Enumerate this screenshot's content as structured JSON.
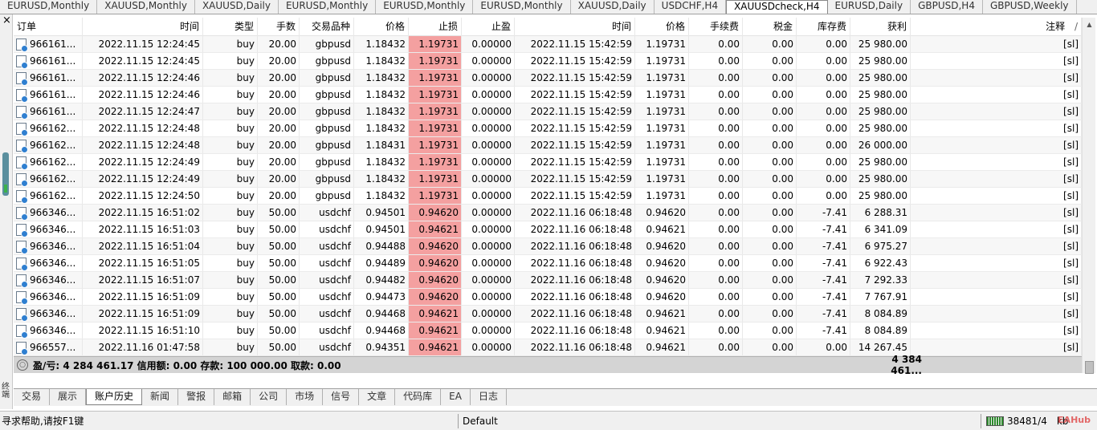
{
  "chart_tabs": [
    {
      "label": "EURUSD,Monthly"
    },
    {
      "label": "XAUUSD,Monthly"
    },
    {
      "label": "XAUUSD,Daily"
    },
    {
      "label": "EURUSD,Monthly"
    },
    {
      "label": "EURUSD,Monthly"
    },
    {
      "label": "EURUSD,Monthly"
    },
    {
      "label": "XAUUSD,Daily"
    },
    {
      "label": "USDCHF,H4"
    },
    {
      "label": "XAUUSDcheck,H4"
    },
    {
      "label": "EURUSD,Daily"
    },
    {
      "label": "GBPUSD,H4"
    },
    {
      "label": "GBPUSD,Weekly"
    }
  ],
  "active_chart_tab": "XAUUSDcheck,H4",
  "close_glyph": "×",
  "strip_label": "终端",
  "columns": {
    "order": "订单",
    "open_time": "时间",
    "type": "类型",
    "lots": "手数",
    "symbol": "交易品种",
    "open_price": "价格",
    "sl": "止损",
    "tp": "止盈",
    "close_time": "时间",
    "close_price": "价格",
    "commission": "手续费",
    "tax": "税金",
    "swap": "库存费",
    "profit": "获利",
    "comment": "注释"
  },
  "sort_glyph": "/",
  "rows": [
    {
      "order": "966161...",
      "open_time": "2022.11.15 12:24:45",
      "type": "buy",
      "lots": "20.00",
      "symbol": "gbpusd",
      "open_price": "1.18432",
      "sl": "1.19731",
      "tp": "0.00000",
      "close_time": "2022.11.15 15:42:59",
      "close_price": "1.19731",
      "commission": "0.00",
      "tax": "0.00",
      "swap": "0.00",
      "profit": "25 980.00",
      "comment": "[sl]"
    },
    {
      "order": "966161...",
      "open_time": "2022.11.15 12:24:45",
      "type": "buy",
      "lots": "20.00",
      "symbol": "gbpusd",
      "open_price": "1.18432",
      "sl": "1.19731",
      "tp": "0.00000",
      "close_time": "2022.11.15 15:42:59",
      "close_price": "1.19731",
      "commission": "0.00",
      "tax": "0.00",
      "swap": "0.00",
      "profit": "25 980.00",
      "comment": "[sl]"
    },
    {
      "order": "966161...",
      "open_time": "2022.11.15 12:24:46",
      "type": "buy",
      "lots": "20.00",
      "symbol": "gbpusd",
      "open_price": "1.18432",
      "sl": "1.19731",
      "tp": "0.00000",
      "close_time": "2022.11.15 15:42:59",
      "close_price": "1.19731",
      "commission": "0.00",
      "tax": "0.00",
      "swap": "0.00",
      "profit": "25 980.00",
      "comment": "[sl]"
    },
    {
      "order": "966161...",
      "open_time": "2022.11.15 12:24:46",
      "type": "buy",
      "lots": "20.00",
      "symbol": "gbpusd",
      "open_price": "1.18432",
      "sl": "1.19731",
      "tp": "0.00000",
      "close_time": "2022.11.15 15:42:59",
      "close_price": "1.19731",
      "commission": "0.00",
      "tax": "0.00",
      "swap": "0.00",
      "profit": "25 980.00",
      "comment": "[sl]"
    },
    {
      "order": "966161...",
      "open_time": "2022.11.15 12:24:47",
      "type": "buy",
      "lots": "20.00",
      "symbol": "gbpusd",
      "open_price": "1.18432",
      "sl": "1.19731",
      "tp": "0.00000",
      "close_time": "2022.11.15 15:42:59",
      "close_price": "1.19731",
      "commission": "0.00",
      "tax": "0.00",
      "swap": "0.00",
      "profit": "25 980.00",
      "comment": "[sl]"
    },
    {
      "order": "966162...",
      "open_time": "2022.11.15 12:24:48",
      "type": "buy",
      "lots": "20.00",
      "symbol": "gbpusd",
      "open_price": "1.18432",
      "sl": "1.19731",
      "tp": "0.00000",
      "close_time": "2022.11.15 15:42:59",
      "close_price": "1.19731",
      "commission": "0.00",
      "tax": "0.00",
      "swap": "0.00",
      "profit": "25 980.00",
      "comment": "[sl]"
    },
    {
      "order": "966162...",
      "open_time": "2022.11.15 12:24:48",
      "type": "buy",
      "lots": "20.00",
      "symbol": "gbpusd",
      "open_price": "1.18431",
      "sl": "1.19731",
      "tp": "0.00000",
      "close_time": "2022.11.15 15:42:59",
      "close_price": "1.19731",
      "commission": "0.00",
      "tax": "0.00",
      "swap": "0.00",
      "profit": "26 000.00",
      "comment": "[sl]"
    },
    {
      "order": "966162...",
      "open_time": "2022.11.15 12:24:49",
      "type": "buy",
      "lots": "20.00",
      "symbol": "gbpusd",
      "open_price": "1.18432",
      "sl": "1.19731",
      "tp": "0.00000",
      "close_time": "2022.11.15 15:42:59",
      "close_price": "1.19731",
      "commission": "0.00",
      "tax": "0.00",
      "swap": "0.00",
      "profit": "25 980.00",
      "comment": "[sl]"
    },
    {
      "order": "966162...",
      "open_time": "2022.11.15 12:24:49",
      "type": "buy",
      "lots": "20.00",
      "symbol": "gbpusd",
      "open_price": "1.18432",
      "sl": "1.19731",
      "tp": "0.00000",
      "close_time": "2022.11.15 15:42:59",
      "close_price": "1.19731",
      "commission": "0.00",
      "tax": "0.00",
      "swap": "0.00",
      "profit": "25 980.00",
      "comment": "[sl]"
    },
    {
      "order": "966162...",
      "open_time": "2022.11.15 12:24:50",
      "type": "buy",
      "lots": "20.00",
      "symbol": "gbpusd",
      "open_price": "1.18432",
      "sl": "1.19731",
      "tp": "0.00000",
      "close_time": "2022.11.15 15:42:59",
      "close_price": "1.19731",
      "commission": "0.00",
      "tax": "0.00",
      "swap": "0.00",
      "profit": "25 980.00",
      "comment": "[sl]"
    },
    {
      "order": "966346...",
      "open_time": "2022.11.15 16:51:02",
      "type": "buy",
      "lots": "50.00",
      "symbol": "usdchf",
      "open_price": "0.94501",
      "sl": "0.94620",
      "tp": "0.00000",
      "close_time": "2022.11.16 06:18:48",
      "close_price": "0.94620",
      "commission": "0.00",
      "tax": "0.00",
      "swap": "-7.41",
      "profit": "6 288.31",
      "comment": "[sl]"
    },
    {
      "order": "966346...",
      "open_time": "2022.11.15 16:51:03",
      "type": "buy",
      "lots": "50.00",
      "symbol": "usdchf",
      "open_price": "0.94501",
      "sl": "0.94621",
      "tp": "0.00000",
      "close_time": "2022.11.16 06:18:48",
      "close_price": "0.94621",
      "commission": "0.00",
      "tax": "0.00",
      "swap": "-7.41",
      "profit": "6 341.09",
      "comment": "[sl]"
    },
    {
      "order": "966346...",
      "open_time": "2022.11.15 16:51:04",
      "type": "buy",
      "lots": "50.00",
      "symbol": "usdchf",
      "open_price": "0.94488",
      "sl": "0.94620",
      "tp": "0.00000",
      "close_time": "2022.11.16 06:18:48",
      "close_price": "0.94620",
      "commission": "0.00",
      "tax": "0.00",
      "swap": "-7.41",
      "profit": "6 975.27",
      "comment": "[sl]"
    },
    {
      "order": "966346...",
      "open_time": "2022.11.15 16:51:05",
      "type": "buy",
      "lots": "50.00",
      "symbol": "usdchf",
      "open_price": "0.94489",
      "sl": "0.94620",
      "tp": "0.00000",
      "close_time": "2022.11.16 06:18:48",
      "close_price": "0.94620",
      "commission": "0.00",
      "tax": "0.00",
      "swap": "-7.41",
      "profit": "6 922.43",
      "comment": "[sl]"
    },
    {
      "order": "966346...",
      "open_time": "2022.11.15 16:51:07",
      "type": "buy",
      "lots": "50.00",
      "symbol": "usdchf",
      "open_price": "0.94482",
      "sl": "0.94620",
      "tp": "0.00000",
      "close_time": "2022.11.16 06:18:48",
      "close_price": "0.94620",
      "commission": "0.00",
      "tax": "0.00",
      "swap": "-7.41",
      "profit": "7 292.33",
      "comment": "[sl]"
    },
    {
      "order": "966346...",
      "open_time": "2022.11.15 16:51:09",
      "type": "buy",
      "lots": "50.00",
      "symbol": "usdchf",
      "open_price": "0.94473",
      "sl": "0.94620",
      "tp": "0.00000",
      "close_time": "2022.11.16 06:18:48",
      "close_price": "0.94620",
      "commission": "0.00",
      "tax": "0.00",
      "swap": "-7.41",
      "profit": "7 767.91",
      "comment": "[sl]"
    },
    {
      "order": "966346...",
      "open_time": "2022.11.15 16:51:09",
      "type": "buy",
      "lots": "50.00",
      "symbol": "usdchf",
      "open_price": "0.94468",
      "sl": "0.94621",
      "tp": "0.00000",
      "close_time": "2022.11.16 06:18:48",
      "close_price": "0.94621",
      "commission": "0.00",
      "tax": "0.00",
      "swap": "-7.41",
      "profit": "8 084.89",
      "comment": "[sl]"
    },
    {
      "order": "966346...",
      "open_time": "2022.11.15 16:51:10",
      "type": "buy",
      "lots": "50.00",
      "symbol": "usdchf",
      "open_price": "0.94468",
      "sl": "0.94621",
      "tp": "0.00000",
      "close_time": "2022.11.16 06:18:48",
      "close_price": "0.94621",
      "commission": "0.00",
      "tax": "0.00",
      "swap": "-7.41",
      "profit": "8 084.89",
      "comment": "[sl]"
    },
    {
      "order": "966557...",
      "open_time": "2022.11.16 01:47:58",
      "type": "buy",
      "lots": "50.00",
      "symbol": "usdchf",
      "open_price": "0.94351",
      "sl": "0.94621",
      "tp": "0.00000",
      "close_time": "2022.11.16 06:18:48",
      "close_price": "0.94621",
      "commission": "0.00",
      "tax": "0.00",
      "swap": "0.00",
      "profit": "14 267.45",
      "comment": "[sl]"
    }
  ],
  "summary": {
    "text": "盈/亏: 4 284 461.17  信用额: 0.00  存款: 100 000.00  取款: 0.00",
    "total_profit": "4 384 461..."
  },
  "bottom_tabs": [
    {
      "label": "交易"
    },
    {
      "label": "展示"
    },
    {
      "label": "账户历史"
    },
    {
      "label": "新闻"
    },
    {
      "label": "警报"
    },
    {
      "label": "邮箱"
    },
    {
      "label": "公司"
    },
    {
      "label": "市场"
    },
    {
      "label": "信号"
    },
    {
      "label": "文章"
    },
    {
      "label": "代码库"
    },
    {
      "label": "EA"
    },
    {
      "label": "日志"
    }
  ],
  "active_bottom_tab": "账户历史",
  "status": {
    "help": "寻求帮助,请按F1键",
    "profile": "Default",
    "traffic": "38481/4",
    "traffic_unit": "kb",
    "watermark": "EAHub"
  },
  "colors": {
    "sl_highlight": "#f4a0a0",
    "summary_bg": "#d4d4d4",
    "grid_line": "#e8e8e8"
  }
}
